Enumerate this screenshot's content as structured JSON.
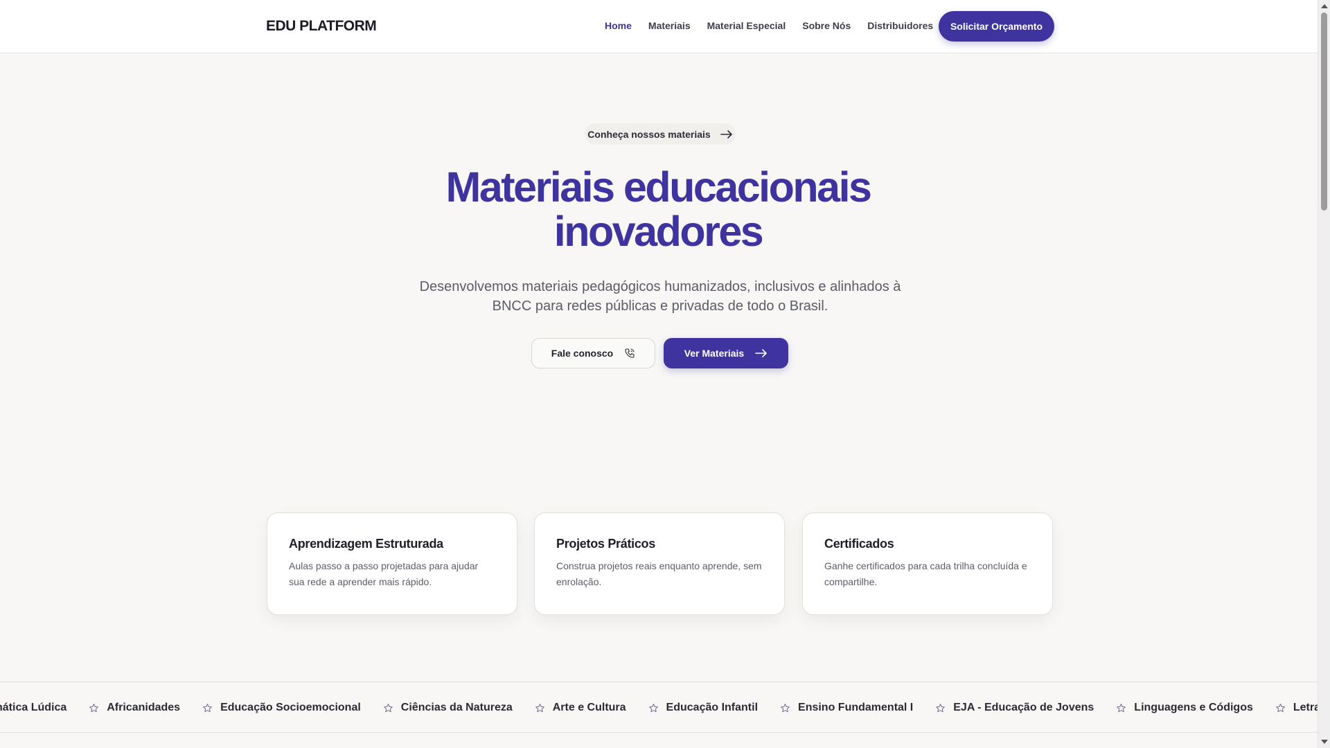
{
  "header": {
    "logo": "EDU PLATFORM",
    "nav": [
      {
        "label": "Home",
        "active": true
      },
      {
        "label": "Materiais"
      },
      {
        "label": "Material Especial"
      },
      {
        "label": "Sobre Nós"
      },
      {
        "label": "Distribuidores"
      }
    ],
    "cta_label": "Solicitar Orçamento"
  },
  "hero": {
    "pill_label": "Conheça nossos materiais",
    "title_line1": "Materiais educacionais",
    "title_line2": "inovadores",
    "subtitle": "Desenvolvemos materiais pedagógicos humanizados, inclusivos e alinhados à BNCC para redes públicas e privadas de todo o Brasil.",
    "secondary_button": "Fale conosco",
    "primary_button": "Ver Materiais"
  },
  "features": [
    {
      "title": "Aprendizagem Estruturada",
      "text": "Aulas passo a passo projetadas para ajudar sua rede a aprender mais rápido."
    },
    {
      "title": "Projetos Práticos",
      "text": "Construa projetos reais enquanto aprende, sem enrolação."
    },
    {
      "title": "Certificados",
      "text": "Ganhe certificados para cada trilha concluída e compartilhe."
    }
  ],
  "marquee": [
    "nática Lúdica",
    "Africanidades",
    "Educação Socioemocional",
    "Ciências da Natureza",
    "Arte e Cultura",
    "Educação Infantil",
    "Ensino Fundamental I",
    "EJA - Educação de Jovens",
    "Linguagens e Códigos",
    "Letramento e Alfab"
  ],
  "colors": {
    "brand": "#3f33a0",
    "background": "#f8f7f5"
  },
  "icons": {
    "pill": "arrow-right-icon",
    "secondary_button": "phone-icon",
    "primary_button": "arrow-right-icon",
    "marquee": "star-icon"
  }
}
